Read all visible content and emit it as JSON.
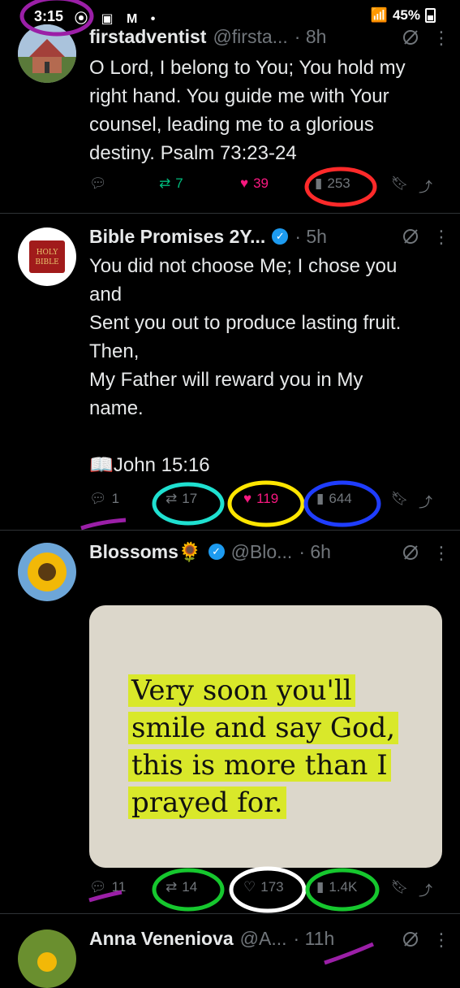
{
  "status_bar": {
    "time": "3:15",
    "left_icons": "⦿ ▣ M •",
    "battery": "45%"
  },
  "tweets": [
    {
      "name": "firstadventist",
      "handle": "@firsta...",
      "time": "· 8h",
      "text": "O Lord, I belong to You; You hold my right hand. You guide me with Your counsel, leading me to a glorious destiny.  Psalm 73:23-24",
      "reply": "",
      "retweet": "7",
      "like": "39",
      "views": "253",
      "avatar": "church-avatar"
    },
    {
      "name": "Bible Promises 2Y...",
      "handle": "",
      "time": "· 5h",
      "text": "You did not choose Me; I chose you\nand\nSent you out to produce lasting fruit.\nThen,\nMy Father will reward you in My\nname.\n\n📖John 15:16",
      "reply": "1",
      "retweet": "17",
      "like": "119",
      "views": "644",
      "avatar_text": "HOLY BIBLE"
    },
    {
      "name": "Blossoms🌻",
      "handle": "@Blo...",
      "time": "· 6h",
      "media_text": [
        "Very soon you'll",
        "smile and say God,",
        "this is more than I",
        "prayed for."
      ],
      "reply": "11",
      "retweet": "14",
      "like": "173",
      "views": "1.4K",
      "avatar": "sunflower-avatar"
    },
    {
      "name": "Anna Veneniova",
      "handle": "@A...",
      "time": "· 11h"
    }
  ],
  "colors": {
    "accent_blue": "#1d9bf0",
    "retweet_green": "#00ba7c",
    "like_pink": "#f91880",
    "muted_gray": "#71767b"
  }
}
